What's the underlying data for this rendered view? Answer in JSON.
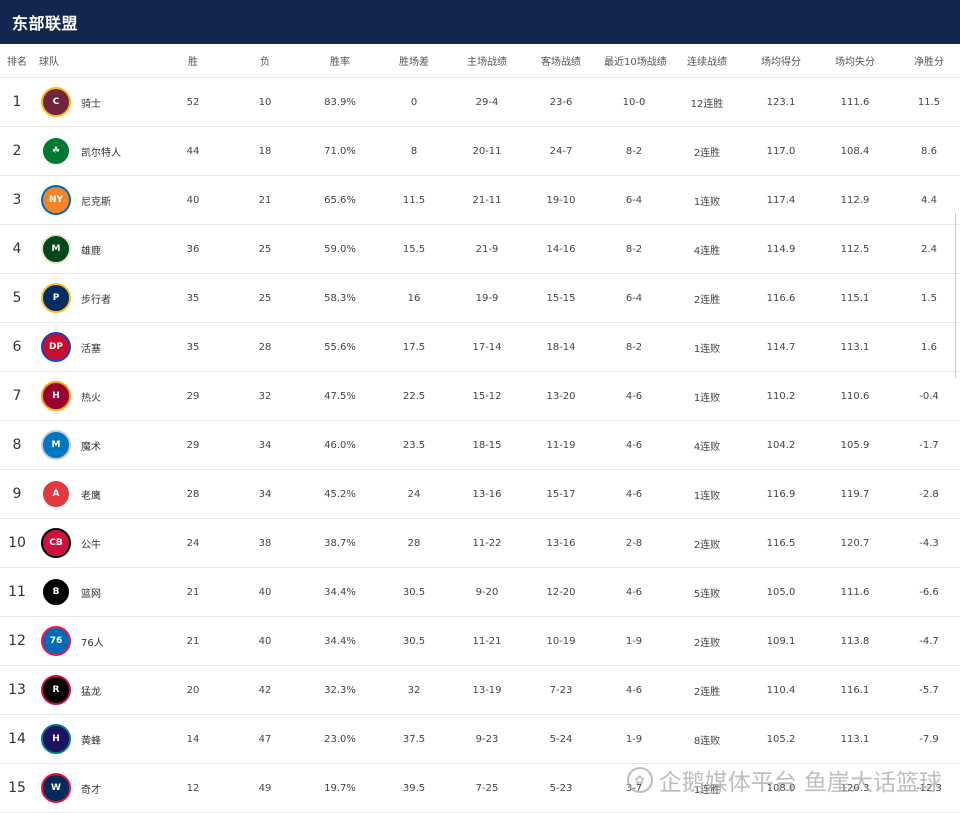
{
  "header": {
    "title": "东部联盟"
  },
  "columns": [
    "排名",
    "球队",
    "胜",
    "负",
    "胜率",
    "胜场差",
    "主场战绩",
    "客场战绩",
    "最近10场战绩",
    "连续战绩",
    "场均得分",
    "场均失分",
    "净胜分"
  ],
  "teams": [
    {
      "rank": "1",
      "name": "骑士",
      "w": "52",
      "l": "10",
      "pct": "83.9%",
      "gb": "0",
      "home": "29-4",
      "away": "23-6",
      "l10": "10-0",
      "strk": "12连胜",
      "ppg": "123.1",
      "opp": "111.6",
      "diff": "11.5",
      "logo": {
        "icon": "cavaliers-logo-icon",
        "text": "C",
        "bg": "#6f263d",
        "border": "#ffb81c"
      }
    },
    {
      "rank": "2",
      "name": "凯尔特人",
      "w": "44",
      "l": "18",
      "pct": "71.0%",
      "gb": "8",
      "home": "20-11",
      "away": "24-7",
      "l10": "8-2",
      "strk": "2连胜",
      "ppg": "117.0",
      "opp": "108.4",
      "diff": "8.6",
      "logo": {
        "icon": "celtics-logo-icon",
        "text": "☘",
        "bg": "#007a33",
        "border": "#ffffff"
      }
    },
    {
      "rank": "3",
      "name": "尼克斯",
      "w": "40",
      "l": "21",
      "pct": "65.6%",
      "gb": "11.5",
      "home": "21-11",
      "away": "19-10",
      "l10": "6-4",
      "strk": "1连败",
      "ppg": "117.4",
      "opp": "112.9",
      "diff": "4.4",
      "logo": {
        "icon": "knicks-logo-icon",
        "text": "NY",
        "bg": "#f58426",
        "border": "#006bb6"
      }
    },
    {
      "rank": "4",
      "name": "雄鹿",
      "w": "36",
      "l": "25",
      "pct": "59.0%",
      "gb": "15.5",
      "home": "21-9",
      "away": "14-16",
      "l10": "8-2",
      "strk": "4连胜",
      "ppg": "114.9",
      "opp": "112.5",
      "diff": "2.4",
      "logo": {
        "icon": "bucks-logo-icon",
        "text": "M",
        "bg": "#00471b",
        "border": "#eee1c6"
      }
    },
    {
      "rank": "5",
      "name": "步行者",
      "w": "35",
      "l": "25",
      "pct": "58.3%",
      "gb": "16",
      "home": "19-9",
      "away": "15-15",
      "l10": "6-4",
      "strk": "2连胜",
      "ppg": "116.6",
      "opp": "115.1",
      "diff": "1.5",
      "logo": {
        "icon": "pacers-logo-icon",
        "text": "P",
        "bg": "#002d62",
        "border": "#fdbb30"
      }
    },
    {
      "rank": "6",
      "name": "活塞",
      "w": "35",
      "l": "28",
      "pct": "55.6%",
      "gb": "17.5",
      "home": "17-14",
      "away": "18-14",
      "l10": "8-2",
      "strk": "1连败",
      "ppg": "114.7",
      "opp": "113.1",
      "diff": "1.6",
      "logo": {
        "icon": "pistons-logo-icon",
        "text": "DP",
        "bg": "#c8102e",
        "border": "#1d42ba"
      }
    },
    {
      "rank": "7",
      "name": "热火",
      "w": "29",
      "l": "32",
      "pct": "47.5%",
      "gb": "22.5",
      "home": "15-12",
      "away": "13-20",
      "l10": "4-6",
      "strk": "1连败",
      "ppg": "110.2",
      "opp": "110.6",
      "diff": "-0.4",
      "logo": {
        "icon": "heat-logo-icon",
        "text": "H",
        "bg": "#98002e",
        "border": "#f9a01b"
      }
    },
    {
      "rank": "8",
      "name": "魔术",
      "w": "29",
      "l": "34",
      "pct": "46.0%",
      "gb": "23.5",
      "home": "18-15",
      "away": "11-19",
      "l10": "4-6",
      "strk": "4连败",
      "ppg": "104.2",
      "opp": "105.9",
      "diff": "-1.7",
      "logo": {
        "icon": "magic-logo-icon",
        "text": "M",
        "bg": "#0077c0",
        "border": "#c4ced4"
      }
    },
    {
      "rank": "9",
      "name": "老鹰",
      "w": "28",
      "l": "34",
      "pct": "45.2%",
      "gb": "24",
      "home": "13-16",
      "away": "15-17",
      "l10": "4-6",
      "strk": "1连败",
      "ppg": "116.9",
      "opp": "119.7",
      "diff": "-2.8",
      "logo": {
        "icon": "hawks-logo-icon",
        "text": "A",
        "bg": "#e03a3e",
        "border": "#ffffff"
      }
    },
    {
      "rank": "10",
      "name": "公牛",
      "w": "24",
      "l": "38",
      "pct": "38.7%",
      "gb": "28",
      "home": "11-22",
      "away": "13-16",
      "l10": "2-8",
      "strk": "2连败",
      "ppg": "116.5",
      "opp": "120.7",
      "diff": "-4.3",
      "logo": {
        "icon": "bulls-logo-icon",
        "text": "CB",
        "bg": "#ce1141",
        "border": "#000000"
      }
    },
    {
      "rank": "11",
      "name": "篮网",
      "w": "21",
      "l": "40",
      "pct": "34.4%",
      "gb": "30.5",
      "home": "9-20",
      "away": "12-20",
      "l10": "4-6",
      "strk": "5连败",
      "ppg": "105.0",
      "opp": "111.6",
      "diff": "-6.6",
      "logo": {
        "icon": "nets-logo-icon",
        "text": "B",
        "bg": "#000000",
        "border": "#ffffff"
      }
    },
    {
      "rank": "12",
      "name": "76人",
      "w": "21",
      "l": "40",
      "pct": "34.4%",
      "gb": "30.5",
      "home": "11-21",
      "away": "10-19",
      "l10": "1-9",
      "strk": "2连败",
      "ppg": "109.1",
      "opp": "113.8",
      "diff": "-4.7",
      "logo": {
        "icon": "sixers-logo-icon",
        "text": "76",
        "bg": "#006bb6",
        "border": "#ed174c"
      }
    },
    {
      "rank": "13",
      "name": "猛龙",
      "w": "20",
      "l": "42",
      "pct": "32.3%",
      "gb": "32",
      "home": "13-19",
      "away": "7-23",
      "l10": "4-6",
      "strk": "2连胜",
      "ppg": "110.4",
      "opp": "116.1",
      "diff": "-5.7",
      "logo": {
        "icon": "raptors-logo-icon",
        "text": "R",
        "bg": "#000000",
        "border": "#ce1141"
      }
    },
    {
      "rank": "14",
      "name": "黄蜂",
      "w": "14",
      "l": "47",
      "pct": "23.0%",
      "gb": "37.5",
      "home": "9-23",
      "away": "5-24",
      "l10": "1-9",
      "strk": "8连败",
      "ppg": "105.2",
      "opp": "113.1",
      "diff": "-7.9",
      "logo": {
        "icon": "hornets-logo-icon",
        "text": "H",
        "bg": "#1d1160",
        "border": "#00788c"
      }
    },
    {
      "rank": "15",
      "name": "奇才",
      "w": "12",
      "l": "49",
      "pct": "19.7%",
      "gb": "39.5",
      "home": "7-25",
      "away": "5-23",
      "l10": "3-7",
      "strk": "1连胜",
      "ppg": "108.0",
      "opp": "120.3",
      "diff": "-12.3",
      "logo": {
        "icon": "wizards-logo-icon",
        "text": "W",
        "bg": "#002b5c",
        "border": "#e31837"
      }
    }
  ],
  "watermark": {
    "text": "企鹅媒体平台 鱼崖大话篮球",
    "icon": "penguin-icon"
  }
}
